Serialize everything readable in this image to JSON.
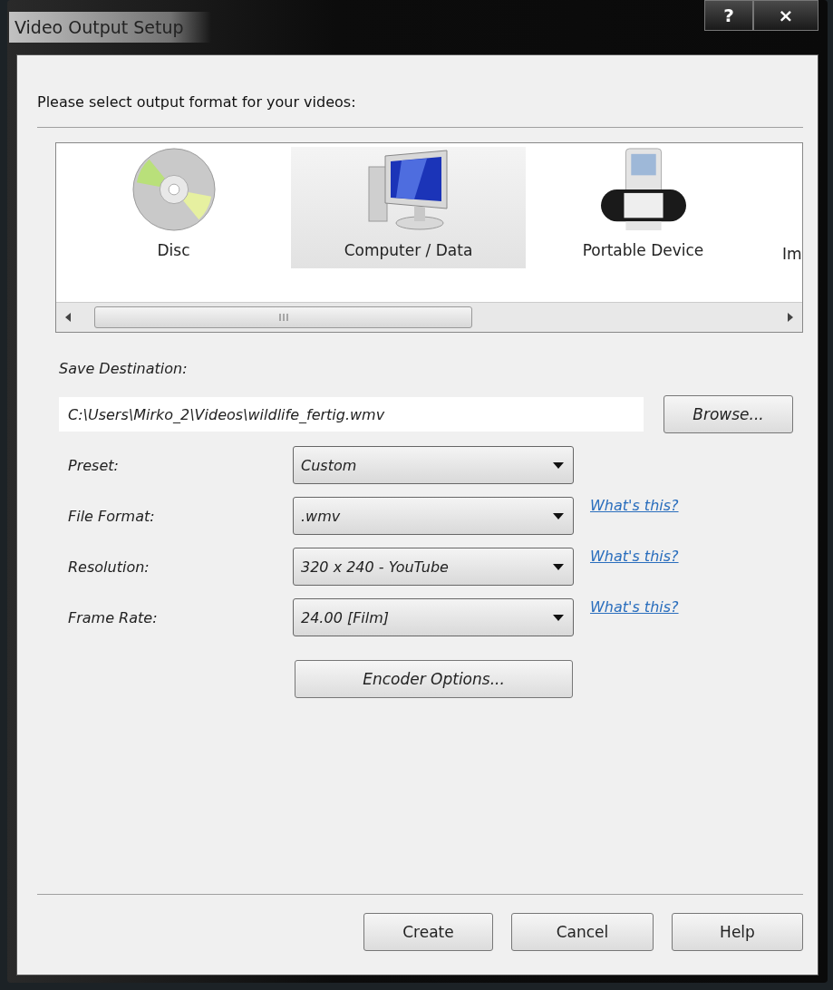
{
  "window": {
    "title": "Video Output Setup",
    "controls": [
      {
        "kind": "help",
        "label": "?"
      },
      {
        "kind": "close",
        "label": "×"
      }
    ]
  },
  "prompt": "Please select output format for your videos:",
  "formats": [
    {
      "kind": "disc",
      "label": "Disc",
      "selected": false
    },
    {
      "kind": "computer",
      "label": "Computer / Data",
      "selected": true
    },
    {
      "kind": "portable",
      "label": "Portable Device",
      "selected": false
    },
    {
      "kind": "cut",
      "label": "Im",
      "selected": false
    }
  ],
  "destination": {
    "label": "Save Destination:",
    "value": "C:\\Users\\Mirko_2\\Videos\\wildlife_fertig.wmv",
    "browse": "Browse..."
  },
  "settings": [
    {
      "label": "Preset:",
      "value": "Custom"
    },
    {
      "label": "File Format:",
      "value": ".wmv",
      "link": "What's this?"
    },
    {
      "label": "Resolution:",
      "value": "320 x 240 - YouTube",
      "link": "What's this?"
    },
    {
      "label": "Frame Rate:",
      "value": "24.00 [Film]",
      "link": "What's this?"
    }
  ],
  "encoder_button": "Encoder Options...",
  "buttons": [
    "Create",
    "Cancel",
    "Help"
  ]
}
